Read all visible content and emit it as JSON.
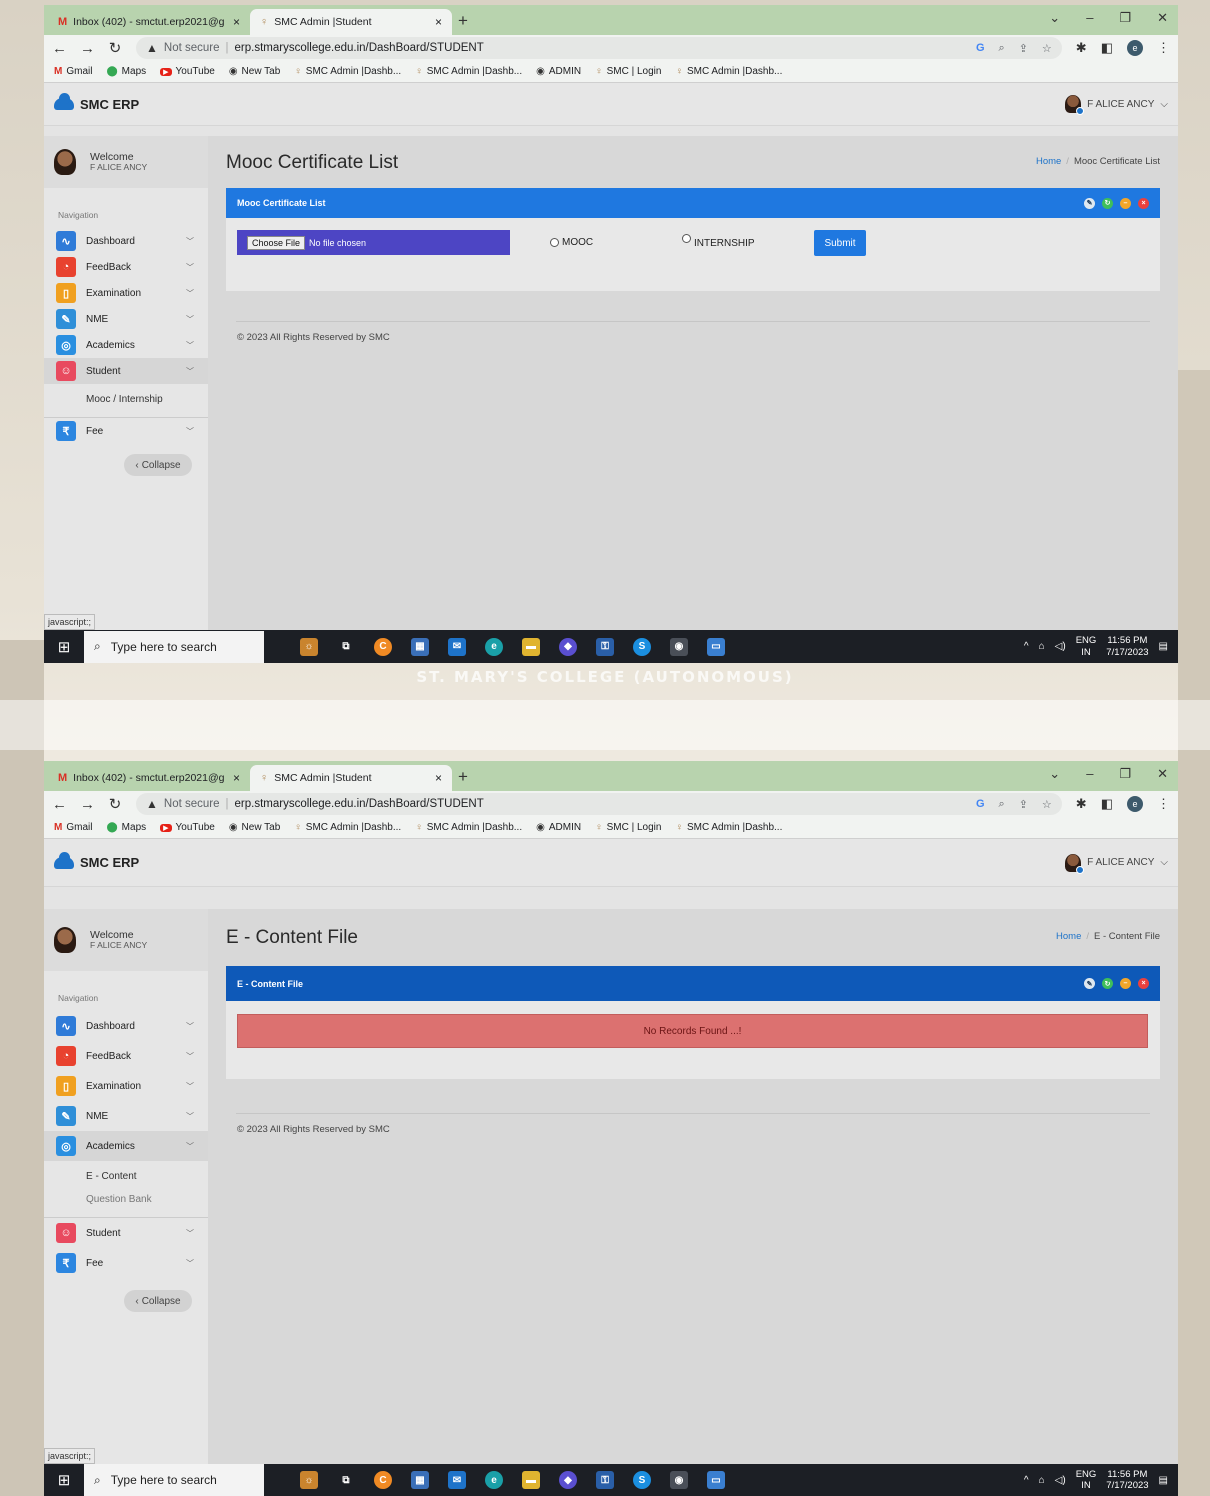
{
  "background": {
    "banner_text": "ST. MARY'S COLLEGE (AUTONOMOUS)"
  },
  "browser": {
    "tabs": [
      {
        "label": "Inbox (402) - smctut.erp2021@g",
        "icon": "gmail-icon"
      },
      {
        "label": "SMC Admin |Student",
        "icon": "smc-icon"
      }
    ],
    "address": {
      "not_secure": "Not secure",
      "url": "erp.stmaryscollege.edu.in/DashBoard/STUDENT"
    },
    "bookmarks": [
      "Gmail",
      "Maps",
      "YouTube",
      "New Tab",
      "SMC Admin |Dashb...",
      "SMC Admin |Dashb...",
      "ADMIN",
      "SMC | Login",
      "SMC Admin |Dashb..."
    ],
    "profile_letter": "e"
  },
  "app": {
    "brand": "SMC ERP",
    "user": "F ALICE ANCY",
    "welcome": "Welcome",
    "welcome_name": "F ALICE ANCY",
    "navigation_label": "Navigation",
    "collapse": "Collapse",
    "status_text": "javascript:;",
    "footer": "© 2023 All Rights Reserved by SMC",
    "breadcrumb_home": "Home"
  },
  "window1": {
    "nav": [
      "Dashboard",
      "FeedBack",
      "Examination",
      "NME",
      "Academics",
      "Student",
      "Fee"
    ],
    "submenu": [
      "Mooc / Internship"
    ],
    "page_title": "Mooc Certificate List",
    "breadcrumb_current": "Mooc Certificate List",
    "panel_title": "Mooc Certificate List",
    "choose_file": "Choose File",
    "no_file": "No file chosen",
    "radio_mooc": "MOOC",
    "radio_internship": "INTERNSHIP",
    "submit": "Submit"
  },
  "window2": {
    "nav": [
      "Dashboard",
      "FeedBack",
      "Examination",
      "NME",
      "Academics",
      "Student",
      "Fee"
    ],
    "submenu": [
      "E - Content",
      "Question Bank"
    ],
    "page_title": "E - Content File",
    "breadcrumb_current": "E - Content File",
    "panel_title": "E - Content File",
    "no_records": "No Records Found ...!"
  },
  "taskbar": {
    "search_placeholder": "Type here to search",
    "lang_top": "ENG",
    "lang_bottom": "IN",
    "time": "11:56 PM",
    "date": "7/17/2023"
  },
  "colors": {
    "panel_header_1": "#1f78e0",
    "panel_header_2": "#0e59b8",
    "no_records_bg": "#dc7170",
    "tab_strip": "#b8d3ae"
  }
}
